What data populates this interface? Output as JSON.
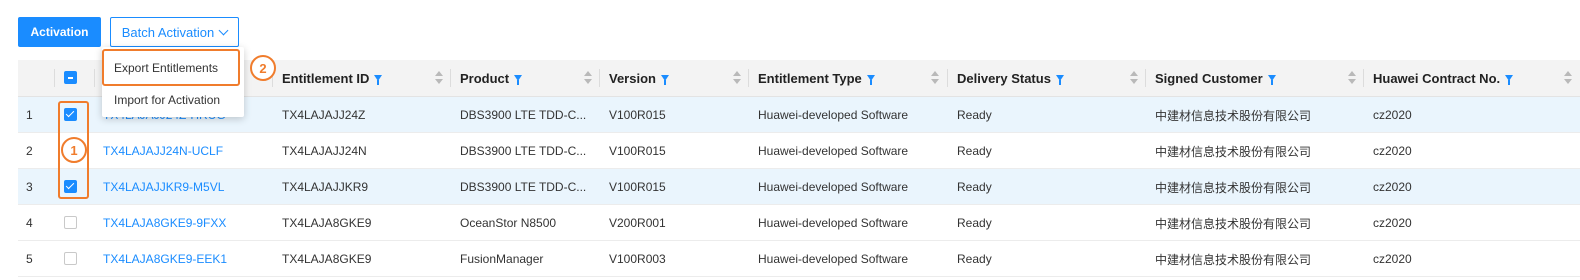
{
  "toolbar": {
    "activation_label": "Activation",
    "batch_activation_label": "Batch Activation"
  },
  "dropdown": {
    "items": [
      "Export Entitlements",
      "Import for Activation"
    ]
  },
  "callouts": [
    "1",
    "2"
  ],
  "table": {
    "columns": [
      "Entitlement ID",
      "Product",
      "Version",
      "Entitlement Type",
      "Delivery Status",
      "Signed Customer",
      "Huawei Contract No."
    ],
    "rows": [
      {
        "index": "1",
        "selected": true,
        "link": "TX4LAJAJJ24Z-HRUG",
        "id": "TX4LAJAJJ24Z",
        "product": "DBS3900 LTE TDD-C...",
        "version": "V100R015",
        "type": "Huawei-developed Software",
        "status": "Ready",
        "customer": "中建材信息技术股份有限公司",
        "contract": "cz2020"
      },
      {
        "index": "2",
        "selected": false,
        "link": "TX4LAJAJJ24N-UCLF",
        "id": "TX4LAJAJJ24N",
        "product": "DBS3900 LTE TDD-C...",
        "version": "V100R015",
        "type": "Huawei-developed Software",
        "status": "Ready",
        "customer": "中建材信息技术股份有限公司",
        "contract": "cz2020"
      },
      {
        "index": "3",
        "selected": true,
        "link": "TX4LAJAJJKR9-M5VL",
        "id": "TX4LAJAJJKR9",
        "product": "DBS3900 LTE TDD-C...",
        "version": "V100R015",
        "type": "Huawei-developed Software",
        "status": "Ready",
        "customer": "中建材信息技术股份有限公司",
        "contract": "cz2020"
      },
      {
        "index": "4",
        "selected": false,
        "link": "TX4LAJA8GKE9-9FXX",
        "id": "TX4LAJA8GKE9",
        "product": "OceanStor N8500",
        "version": "V200R001",
        "type": "Huawei-developed Software",
        "status": "Ready",
        "customer": "中建材信息技术股份有限公司",
        "contract": "cz2020"
      },
      {
        "index": "5",
        "selected": false,
        "link": "TX4LAJA8GKE9-EEK1",
        "id": "TX4LAJA8GKE9",
        "product": "FusionManager",
        "version": "V100R003",
        "type": "Huawei-developed Software",
        "status": "Ready",
        "customer": "中建材信息技术股份有限公司",
        "contract": "cz2020"
      }
    ]
  },
  "colors": {
    "accent": "#1a8cff",
    "highlight": "#f07c2c",
    "selected_row": "#eaf5fd"
  }
}
